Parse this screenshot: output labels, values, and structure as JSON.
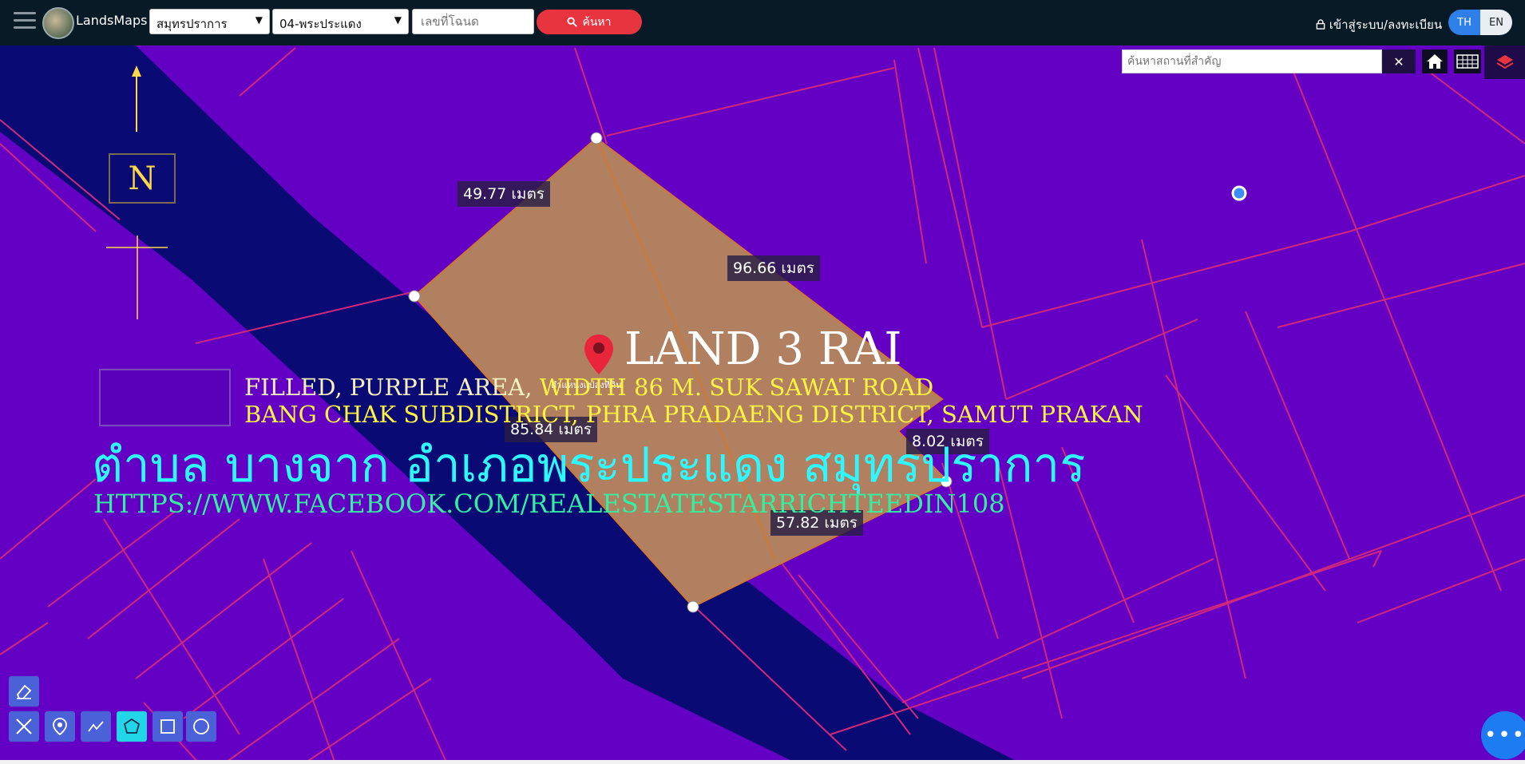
{
  "header": {
    "brand": "LandsMaps",
    "province_select": "สมุทรปราการ",
    "district_select": "04-พระประแดง",
    "deed_placeholder": "เลขที่โฉนด",
    "search_label": "ค้นหา",
    "login_label": "เข้าสู่ระบบ/ลงทะเบียน",
    "lang_th": "TH",
    "lang_en": "EN"
  },
  "map": {
    "place_search_placeholder": "ค้นหาสถานที่สำคัญ",
    "clear_label": "✕",
    "compass_letter": "N",
    "measurements": {
      "top_left": "49.77 เมตร",
      "top_right": "96.66 เมตร",
      "left": "85.84 เมตร",
      "right_small": "8.02 เมตร",
      "bottom": "57.82 เมตร"
    },
    "tiny_label": "ตำแหน่งแปลงที่ดิน",
    "overlay": {
      "title": "LAND 3 RAI",
      "line1_a": "FILLED, PURPLE AREA, ",
      "line1_b": "WIDTH 86 M. SUK SAWAT ROAD",
      "line2": "BANG CHAK SUBDISTRICT, PHRA PRADAENG DISTRICT, SAMUT PRAKAN",
      "thai_line": "ตำบล บางจาก อำเภอพระประแดง สมุทรปราการ",
      "url": "HTTPS://WWW.FACEBOOK.COM/REALESTATESTARRICHTEEDIN108"
    }
  },
  "colors": {
    "map_bg": "#6300c4",
    "river": "#090a74",
    "parcel_lines": "#d0287c",
    "plot_fill": "#b08060",
    "header_bg": "#081a26",
    "accent_red": "#e8343e",
    "overlay_yellow": "#fff240",
    "overlay_cyan": "#2ff7ff",
    "overlay_green": "#33f0a0"
  },
  "icons": {
    "menu": "hamburger-icon",
    "search": "magnifier-icon",
    "login": "lock-icon",
    "home": "home-icon",
    "grid": "grid-icon",
    "layers": "layers-icon",
    "pin": "map-pin-icon",
    "chat": "more-dots-icon"
  }
}
